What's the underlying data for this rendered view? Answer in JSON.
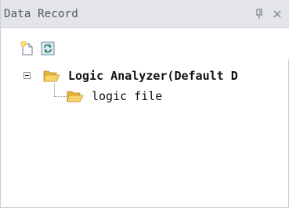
{
  "panel": {
    "title": "Data Record",
    "pin_glyph": "久",
    "close_glyph": "✕"
  },
  "toolbar": {
    "buttons": [
      {
        "icon": "new-document-icon"
      },
      {
        "icon": "refresh-icon"
      }
    ]
  },
  "tree": {
    "root": {
      "label": "Logic Analyzer(Default D",
      "expanded": true,
      "children": [
        {
          "label": "logic file"
        }
      ]
    }
  },
  "colors": {
    "titlebar_bg": "#e3e5e9",
    "folder_yellow": "#f2c14e",
    "refresh_green": "#2e8b3a"
  }
}
